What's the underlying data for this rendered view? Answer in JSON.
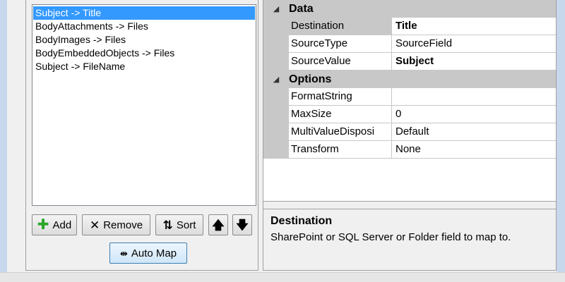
{
  "mappings": {
    "items": [
      {
        "label": "Subject -> Title",
        "selected": true
      },
      {
        "label": "BodyAttachments -> Files",
        "selected": false
      },
      {
        "label": "BodyImages -> Files",
        "selected": false
      },
      {
        "label": "BodyEmbeddedObjects -> Files",
        "selected": false
      },
      {
        "label": "Subject -> FileName",
        "selected": false
      }
    ]
  },
  "toolbar": {
    "add_label": "Add",
    "remove_label": "Remove",
    "sort_label": "Sort",
    "automap_label": "Auto Map"
  },
  "properties": {
    "categories": [
      {
        "name": "Data",
        "rows": [
          {
            "name": "Destination",
            "value": "Title",
            "bold": true
          },
          {
            "name": "SourceType",
            "value": "SourceField",
            "bold": false
          },
          {
            "name": "SourceValue",
            "value": "Subject",
            "bold": true
          }
        ]
      },
      {
        "name": "Options",
        "rows": [
          {
            "name": "FormatString",
            "value": "",
            "bold": false
          },
          {
            "name": "MaxSize",
            "value": "0",
            "bold": false
          },
          {
            "name": "MultiValueDisposi",
            "value": "Default",
            "bold": false
          },
          {
            "name": "Transform",
            "value": "None",
            "bold": false
          }
        ]
      }
    ]
  },
  "help": {
    "title": "Destination",
    "description": "SharePoint or SQL Server or Folder field to map to."
  },
  "colors": {
    "selection": "#3399ff",
    "category_band": "#c8c8c8",
    "add_icon": "#2aa52a"
  }
}
